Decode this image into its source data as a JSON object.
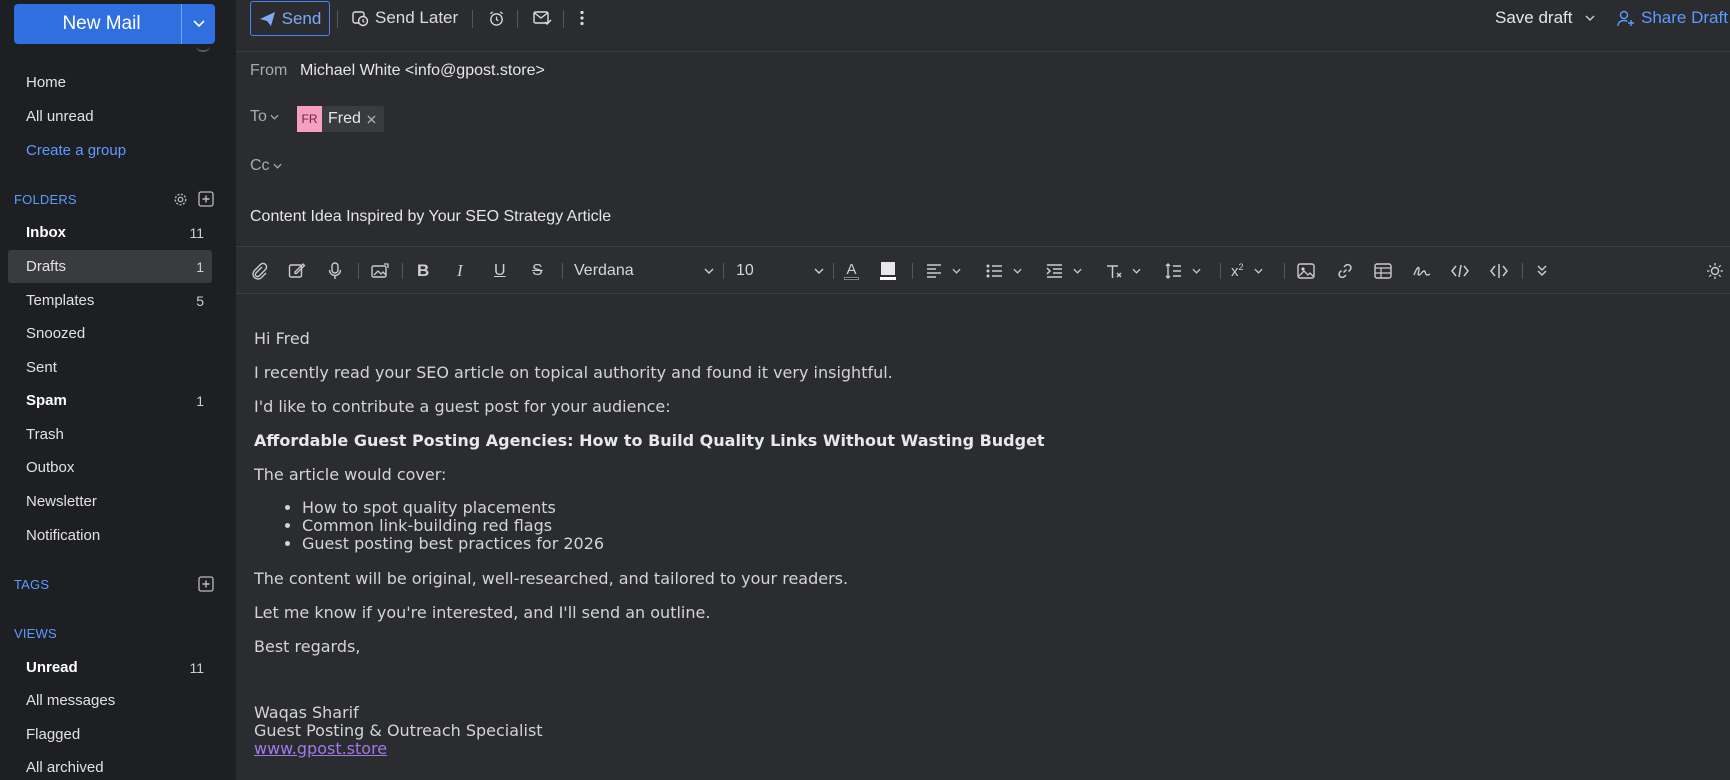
{
  "sidebar": {
    "new_mail": "New Mail",
    "top_items": [
      {
        "label": "Home"
      },
      {
        "label": "All unread"
      },
      {
        "label": "Create a group"
      }
    ],
    "folders_title": "FOLDERS",
    "folders": [
      {
        "label": "Inbox",
        "count": "11"
      },
      {
        "label": "Drafts",
        "count": "1"
      },
      {
        "label": "Templates",
        "count": "5"
      },
      {
        "label": "Snoozed",
        "count": ""
      },
      {
        "label": "Sent",
        "count": ""
      },
      {
        "label": "Spam",
        "count": "1"
      },
      {
        "label": "Trash",
        "count": ""
      },
      {
        "label": "Outbox",
        "count": ""
      },
      {
        "label": "Newsletter",
        "count": ""
      },
      {
        "label": "Notification",
        "count": ""
      }
    ],
    "tags_title": "TAGS",
    "views_title": "VIEWS",
    "views": [
      {
        "label": "Unread",
        "count": "11"
      },
      {
        "label": "All messages",
        "count": ""
      },
      {
        "label": "Flagged",
        "count": ""
      },
      {
        "label": "All archived",
        "count": ""
      }
    ]
  },
  "toolbar": {
    "send": "Send",
    "send_later": "Send Later",
    "save_draft": "Save draft",
    "share_draft": "Share Draft"
  },
  "compose": {
    "from_label": "From",
    "from_value": "Michael White <info@gpost.store>",
    "to_label": "To",
    "to_chip": {
      "initials": "FR",
      "name": "Fred"
    },
    "cc_label": "Cc",
    "subject": "Content Idea Inspired by Your SEO Strategy Article"
  },
  "format": {
    "font": "Verdana",
    "size": "10"
  },
  "body": {
    "greeting": "Hi Fred",
    "p1": "I recently read your SEO article on topical authority and found it very insightful.",
    "p2": "I'd like to contribute a guest post for your audience:",
    "title": "Affordable Guest Posting Agencies: How to Build Quality Links Without Wasting Budget",
    "p3": "The article would cover:",
    "bullets": [
      "How to spot quality placements",
      "Common link-building red flags",
      "Guest posting best practices for 2026"
    ],
    "p4": "The content will be original, well-researched, and tailored to your readers.",
    "p5": "Let me know if you're interested, and I'll send an outline.",
    "closing": "Best regards,",
    "sig_name": "Waqas Sharif",
    "sig_title": "Guest Posting & Outreach Specialist",
    "sig_link": "www.gpost.store"
  },
  "colors": {
    "accent": "#2f6fe0",
    "link": "#5b9cff",
    "sidebar_bg": "#1e1f22",
    "main_bg": "#2b2c2f"
  }
}
